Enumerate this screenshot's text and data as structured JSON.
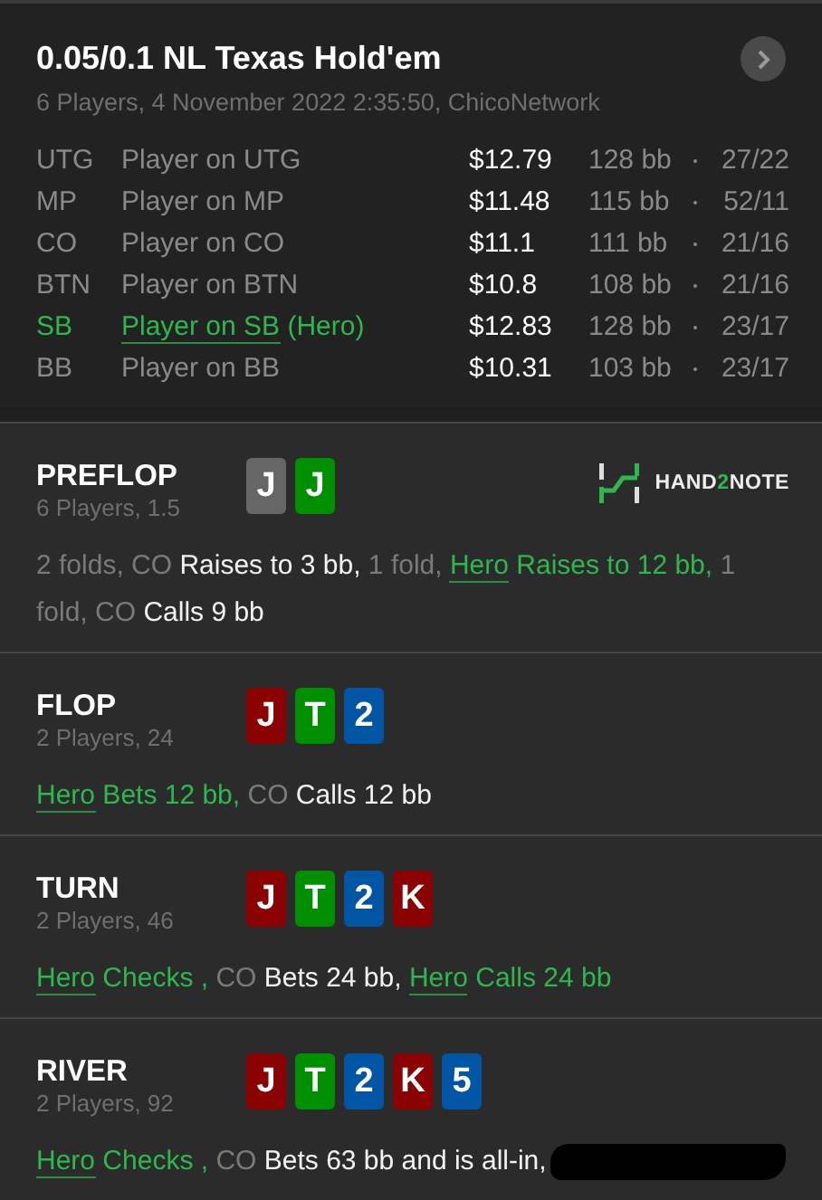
{
  "header": {
    "title": "0.05/0.1 NL Texas Hold'em",
    "subtitle": "6 Players, 4 November 2022 2:35:50, ChicoNetwork"
  },
  "players": [
    {
      "position": "UTG",
      "name": "Player on UTG",
      "hero": false,
      "stack": "$12.79",
      "bb": "128 bb",
      "stats": "27/22"
    },
    {
      "position": "MP",
      "name": "Player on MP",
      "hero": false,
      "stack": "$11.48",
      "bb": "115 bb",
      "stats": "52/11"
    },
    {
      "position": "CO",
      "name": "Player on CO",
      "hero": false,
      "stack": "$11.1",
      "bb": "111 bb",
      "stats": "21/16"
    },
    {
      "position": "BTN",
      "name": "Player on BTN",
      "hero": false,
      "stack": "$10.8",
      "bb": "108 bb",
      "stats": "21/16"
    },
    {
      "position": "SB",
      "name": "Player on SB",
      "tag": "(Hero)",
      "hero": true,
      "stack": "$12.83",
      "bb": "128 bb",
      "stats": "23/17"
    },
    {
      "position": "BB",
      "name": "Player on BB",
      "hero": false,
      "stack": "$10.31",
      "bb": "103 bb",
      "stats": "23/17"
    }
  ],
  "streets": [
    {
      "name": "PREFLOP",
      "info": "6 Players, 1.5",
      "logo": {
        "parts": [
          {
            "text": "HAND",
            "accent": false
          },
          {
            "text": "2",
            "accent": true
          },
          {
            "text": "NOTE",
            "accent": false
          }
        ]
      },
      "cards": [
        {
          "rank": "J",
          "color": "#666666"
        },
        {
          "rank": "J",
          "color": "#008f00"
        }
      ],
      "actions": [
        {
          "text": "2 folds, CO ",
          "kind": "muted"
        },
        {
          "text": "Raises to 3 bb,",
          "kind": "action"
        },
        {
          "text": " 1 fold, ",
          "kind": "muted"
        },
        {
          "text": "Hero",
          "kind": "hero_link"
        },
        {
          "text": " Raises to 12 bb,",
          "kind": "hero"
        },
        {
          "text": " 1 fold, CO ",
          "kind": "muted"
        },
        {
          "text": "Calls 9 bb",
          "kind": "action"
        }
      ]
    },
    {
      "name": "FLOP",
      "info": "2 Players, 24",
      "cards": [
        {
          "rank": "J",
          "color": "#8b0000"
        },
        {
          "rank": "T",
          "color": "#008f00"
        },
        {
          "rank": "2",
          "color": "#0055a5"
        }
      ],
      "actions": [
        {
          "text": "Hero",
          "kind": "hero_link"
        },
        {
          "text": " Bets 12 bb,",
          "kind": "hero"
        },
        {
          "text": " CO ",
          "kind": "muted"
        },
        {
          "text": "Calls 12 bb",
          "kind": "action"
        }
      ]
    },
    {
      "name": "TURN",
      "info": "2 Players, 46",
      "cards": [
        {
          "rank": "J",
          "color": "#8b0000"
        },
        {
          "rank": "T",
          "color": "#008f00"
        },
        {
          "rank": "2",
          "color": "#0055a5"
        },
        {
          "rank": "K",
          "color": "#8b0000"
        }
      ],
      "actions": [
        {
          "text": "Hero",
          "kind": "hero_link"
        },
        {
          "text": " Checks ,",
          "kind": "hero"
        },
        {
          "text": " CO ",
          "kind": "muted"
        },
        {
          "text": "Bets 24 bb, ",
          "kind": "action"
        },
        {
          "text": "Hero",
          "kind": "hero_link"
        },
        {
          "text": " Calls 24 bb",
          "kind": "hero"
        }
      ]
    },
    {
      "name": "RIVER",
      "info": "2 Players, 92",
      "redacted": true,
      "cards": [
        {
          "rank": "J",
          "color": "#8b0000"
        },
        {
          "rank": "T",
          "color": "#008f00"
        },
        {
          "rank": "2",
          "color": "#0055a5"
        },
        {
          "rank": "K",
          "color": "#8b0000"
        },
        {
          "rank": "5",
          "color": "#0055a5"
        }
      ],
      "actions": [
        {
          "text": "Hero",
          "kind": "hero_link"
        },
        {
          "text": " Checks ,",
          "kind": "hero"
        },
        {
          "text": " CO ",
          "kind": "muted"
        },
        {
          "text": "Bets 63 bb and is all-in,",
          "kind": "action"
        }
      ]
    }
  ]
}
